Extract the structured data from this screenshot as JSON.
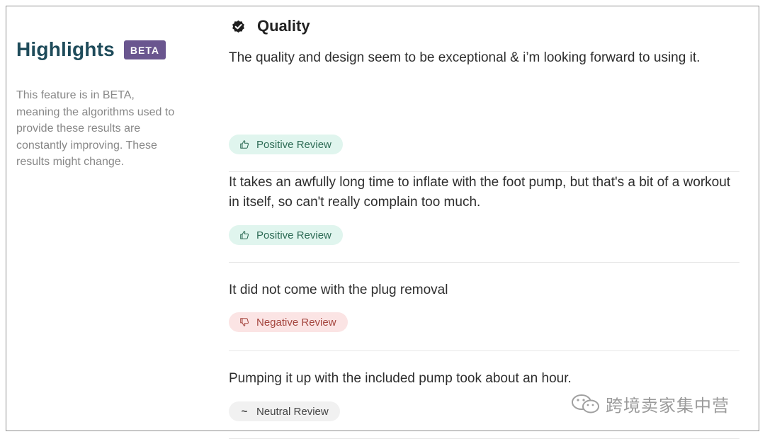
{
  "left": {
    "title": "Highlights",
    "badge": "BETA",
    "description": "This feature is in BETA, meaning the algorithms used to provide these results are constantly improving. These results might change."
  },
  "section": {
    "title": "Quality",
    "icon": "verified-badge-icon"
  },
  "reviews": [
    {
      "text": "The quality and design seem to be exceptional & i’m looking forward to using it.",
      "sentiment": "Positive Review",
      "icon": "thumbs-up-icon"
    },
    {
      "text": "It takes an awfully long time to inflate with the foot pump, but that's a bit of a workout in itself, so can't really complain too much.",
      "sentiment": "Positive Review",
      "icon": "thumbs-up-icon"
    },
    {
      "text": "It did not come with the plug removal",
      "sentiment": "Negative Review",
      "icon": "thumbs-down-icon"
    },
    {
      "text": "Pumping it up with the included pump took about an hour.",
      "sentiment": "Neutral Review",
      "icon": "tilde-icon"
    }
  ],
  "watermark": {
    "text": "跨境卖家集中营"
  },
  "colors": {
    "title": "#1e4b5a",
    "badge": "#6a568f",
    "positive_bg": "#e0f5ee",
    "negative_bg": "#fbe4e4",
    "neutral_bg": "#f1f1f1"
  }
}
